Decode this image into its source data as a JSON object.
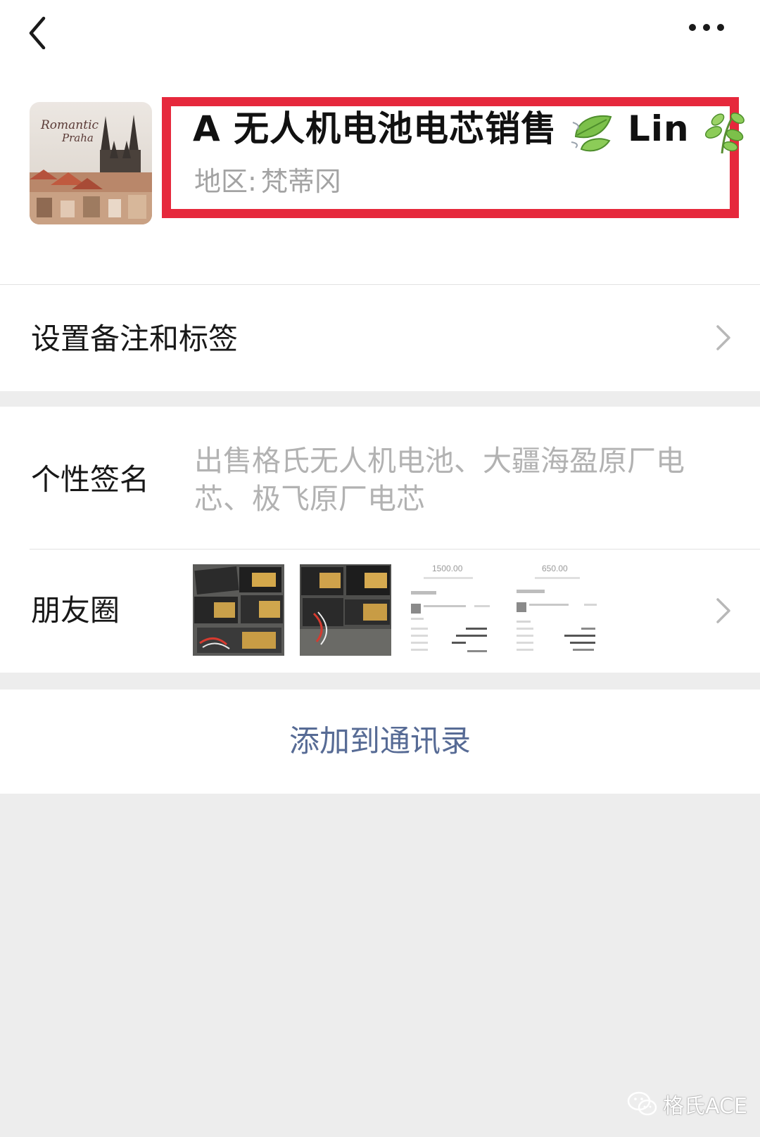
{
  "profile": {
    "nickname_prefix": "A",
    "nickname_main": "无人机电池电芯销售",
    "nickname_suffix": "Lin",
    "region_label": "地区:",
    "region_value": "梵蒂冈",
    "avatar_caption_line1": "Romantic",
    "avatar_caption_line2": "Praha",
    "highlight_color": "#e6283c"
  },
  "icons": {
    "back": "chevron-left-icon",
    "more": "more-dots-icon",
    "leaf_swirl": "leaf-wind-emoji",
    "leaf_branch": "herb-emoji",
    "wechat": "wechat-logo-icon"
  },
  "settings_row": {
    "label": "设置备注和标签"
  },
  "signature_row": {
    "label": "个性签名",
    "value": "出售格氏无人机电池、大疆海盈原厂电芯、极飞原厂电芯"
  },
  "moments_row": {
    "label": "朋友圈",
    "thumbnails": [
      {
        "kind": "battery-photo"
      },
      {
        "kind": "battery-photo"
      },
      {
        "kind": "receipt",
        "amount": "1500.00"
      },
      {
        "kind": "receipt",
        "amount": "650.00"
      }
    ]
  },
  "actions": {
    "add_contact": "添加到通讯录"
  },
  "watermark": {
    "text": "格氏ACE"
  },
  "colors": {
    "link_blue": "#576b95",
    "page_bg": "#ededed",
    "secondary_text": "#a3a3a3"
  }
}
